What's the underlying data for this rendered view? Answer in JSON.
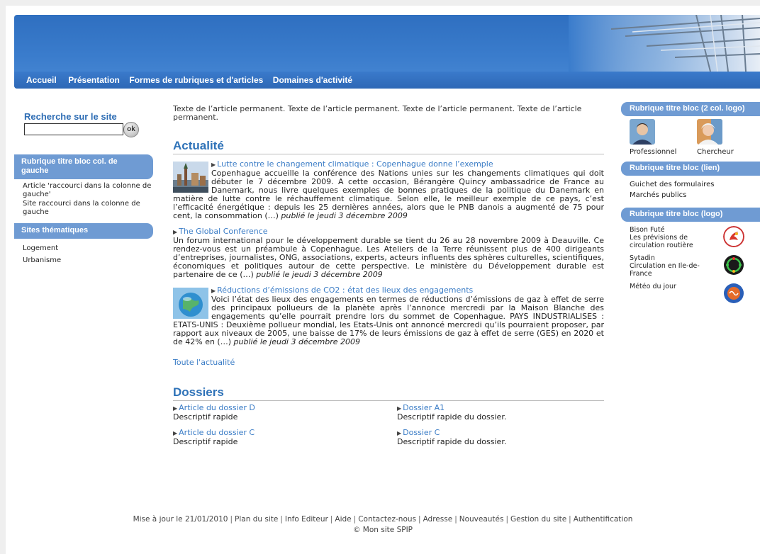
{
  "nav": {
    "items": [
      "Accueil",
      "Présentation",
      "Formes de rubriques et d'articles",
      "Domaines d'activité"
    ]
  },
  "left": {
    "search_title": "Recherche sur le site",
    "search_placeholder": "",
    "ok_label": "ok",
    "bloc1_title": "Rubrique titre bloc col. de gauche",
    "bloc1_items": [
      "Article 'raccourci dans la colonne de gauche'",
      "Site raccourci dans la colonne de gauche"
    ],
    "bloc2_title": "Sites thématiques",
    "bloc2_items": [
      "Logement",
      "Urbanisme"
    ]
  },
  "center": {
    "intro": "Texte de l’article permanent. Texte de l’article permanent. Texte de l’article permanent. Texte de l’article permanent.",
    "news_title": "Actualité",
    "articles": [
      {
        "title": "Lutte contre le changement climatique : Copenhague donne l’exemple",
        "text": "Copenhague accueille la conférence des Nations unies sur les changements climatiques qui doit débuter le 7 décembre 2009. A cette occasion, Bérangère Quincy ambassadrice de France au Danemark, nous livre quelques exemples de bonnes pratiques de la politique du Danemark en matière de lutte contre le réchauffement climatique. Selon elle, le meilleur exemple de ce pays, c’est l’efficacité énergétique : depuis les 25 dernières années, alors que le PNB danois a augmenté de 75 pour cent, la consommation (…)",
        "date": "publié le jeudi 3 décembre 2009"
      },
      {
        "title": "The Global Conference",
        "text": "Un forum international pour le développement durable se tient du 26 au 28 novembre 2009 à Deauville. Ce rendez-vous est un préambule à Copenhague. Les Ateliers de la Terre réunissent plus de 400 dirigeants d’entreprises, journalistes, ONG, associations, experts, acteurs influents des sphères culturelles, scientifiques, économiques et politiques autour de cette perspective. Le ministère du Développement durable est partenaire de ce (…)",
        "date": "publié le jeudi 3 décembre 2009"
      },
      {
        "title": "Réductions d’émissions de CO2 : état des lieux des engagements",
        "text": "Voici l’état des lieux des engagements en termes de réductions d’émissions de gaz à effet de serre des principaux pollueurs de la planète après l’annonce mercredi par la Maison Blanche des engagements qu’elle pourrait prendre lors du sommet de Copenhague. PAYS INDUSTRIALISES : ETATS-UNIS : Deuxième pollueur mondial, les Etats-Unis ont annoncé mercredi qu’ils pourraient proposer, par rapport aux niveaux de 2005, une baisse de 17% de leurs émissions de gaz à effet de serre (GES) en 2020 et de 42% en (…)",
        "date": "publié le jeudi 3 décembre 2009"
      }
    ],
    "all_news": "Toute l'actualité",
    "dossiers_title": "Dossiers",
    "dossiers": [
      {
        "title": "Article du dossier D",
        "desc": "Descriptif rapide"
      },
      {
        "title": "Dossier A1",
        "desc": "Descriptif rapide du dossier."
      },
      {
        "title": "Article du dossier C",
        "desc": "Descriptif rapide"
      },
      {
        "title": "Dossier C",
        "desc": "Descriptif rapide du dossier."
      }
    ]
  },
  "right": {
    "bloc1_title": "Rubrique titre bloc (2 col. logo)",
    "logos": [
      "Professionnel",
      "Chercheur"
    ],
    "bloc2_title": "Rubrique titre bloc (lien)",
    "links": [
      "Guichet des formulaires",
      "Marchés publics"
    ],
    "bloc3_title": "Rubrique titre bloc (logo)",
    "logo_entries": [
      {
        "lines": [
          "Bison Futé",
          "Les prévisions de circulation routière"
        ]
      },
      {
        "lines": [
          "Sytadin",
          "Circulation en Ile-de-France"
        ]
      },
      {
        "lines": [
          "Météo du jour"
        ]
      }
    ]
  },
  "footer": {
    "prefix": "Mise à jour le 21/01/2010",
    "links": [
      "Plan du site",
      "Info Editeur",
      "Aide",
      "Contactez-nous",
      "Adresse",
      "Nouveautés",
      "Gestion du site",
      "Authentification"
    ],
    "copyright": "© Mon site SPIP"
  }
}
